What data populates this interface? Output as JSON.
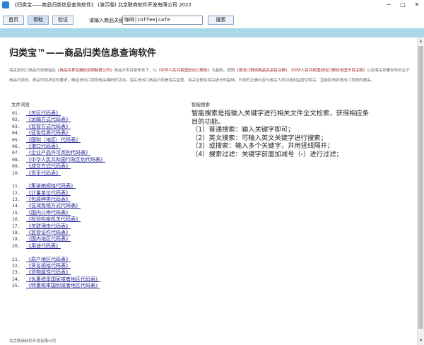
{
  "window": {
    "title": "《归类宝——商品归类信息查询软件》  (演示版)  北京联商软件开发有限公司 2022",
    "min_glyph": "─",
    "max_glyph": "□",
    "close_glyph": "✕"
  },
  "toolbar": {
    "home_label": "首页",
    "help_label": "帮助",
    "verify_label": "验证",
    "keyword_label": "请输入商品关键字:",
    "keyword_value": "咖啡|coffee|cafe",
    "search_label": "搜索"
  },
  "page": {
    "heading": "归类宝™——商品归类信息查询软件",
    "intro": {
      "p1": "海关进出口商品归类是指在",
      "h1": "《商品名称及编码协调制度公约》",
      "p2": "商品分类目录体系下，以",
      "h2": "《中华人民共和国进出口税则》",
      "p3": "为基础，按照",
      "h3": "《进出口税则商品及品目注释》",
      "p4": "、",
      "h4": "《中华人民共和国进出口税则本国子目注释》",
      "p5": "以及海关总署发布的关于商品归类的、商品归类决定的要求，确定进出口货物商品编码的活动。海关进出口商品归类是海关监管、海关征税及海关统计的基础，归类的正确与否与报关人的切身利益密切相关，直接影响到进出口货物的通关。"
    },
    "files_label": "文件浏览",
    "smart_label": "智能搜索",
    "file_groups": [
      [
        {
          "num": "01.",
          "label": "《关区代码表》"
        },
        {
          "num": "02.",
          "label": "《运输方式代码表》"
        },
        {
          "num": "03.",
          "label": "《监管方式代码表》"
        },
        {
          "num": "04.",
          "label": "《征免性质代码表》"
        },
        {
          "num": "05.",
          "label": "《国别（地区）代码表》"
        },
        {
          "num": "06.",
          "label": "《港口代码表》"
        },
        {
          "num": "07.",
          "label": "《企业产品许可类别代码表》"
        },
        {
          "num": "08.",
          "label": "《中华人民共和国行政区划代码表》"
        },
        {
          "num": "09.",
          "label": "《成交方式代码表》"
        },
        {
          "num": "10.",
          "label": "《货币代码表》"
        }
      ],
      [
        {
          "num": "11.",
          "label": "《集装箱规格代码表》"
        },
        {
          "num": "12.",
          "label": "《计量单位代码表》"
        },
        {
          "num": "13.",
          "label": "《包装种类代码表》"
        },
        {
          "num": "14.",
          "label": "《征减免税方式代码表》"
        },
        {
          "num": "15.",
          "label": "《国内口岸代码表》"
        },
        {
          "num": "16.",
          "label": "《检验检疫机关代码表》"
        },
        {
          "num": "17.",
          "label": "《关联理由代码表》"
        },
        {
          "num": "18.",
          "label": "《监管证件代码表》"
        },
        {
          "num": "19.",
          "label": "《国内地区代码表》"
        },
        {
          "num": "20.",
          "label": "《用途代码表》"
        }
      ],
      [
        {
          "num": "21.",
          "label": "《原产地区代码表》"
        },
        {
          "num": "22.",
          "label": "《货名规格代码表》"
        },
        {
          "num": "23.",
          "label": "《货物属性代码表》"
        },
        {
          "num": "24.",
          "label": "《优惠税率国家或者地区代码表》"
        },
        {
          "num": "25.",
          "label": "《特惠税率国别或者地区代码表》"
        }
      ]
    ],
    "smart_lines": [
      "智能搜索是指输入关键字进行相关文件全文检索，获得相应条",
      "目的功能。",
      "（1）普通搜索：输入关键字即可；",
      "（2）英文搜索：可输入英文关键字进行搜索；",
      "（3）或搜索：输入多个关键字，并用竖线隔开；",
      "（4）搜索过滤：关键字前面加减号（-）进行过滤；"
    ],
    "footer": "北京联商软件开发有限公司"
  },
  "colors": {
    "accent_bar": "#a9d8e8",
    "link": "#2a2a9a",
    "intro_highlight": "#a02020"
  },
  "icons": {
    "app": "app-icon",
    "scroll_up": "chevron-up-icon",
    "scroll_down": "chevron-down-icon"
  }
}
